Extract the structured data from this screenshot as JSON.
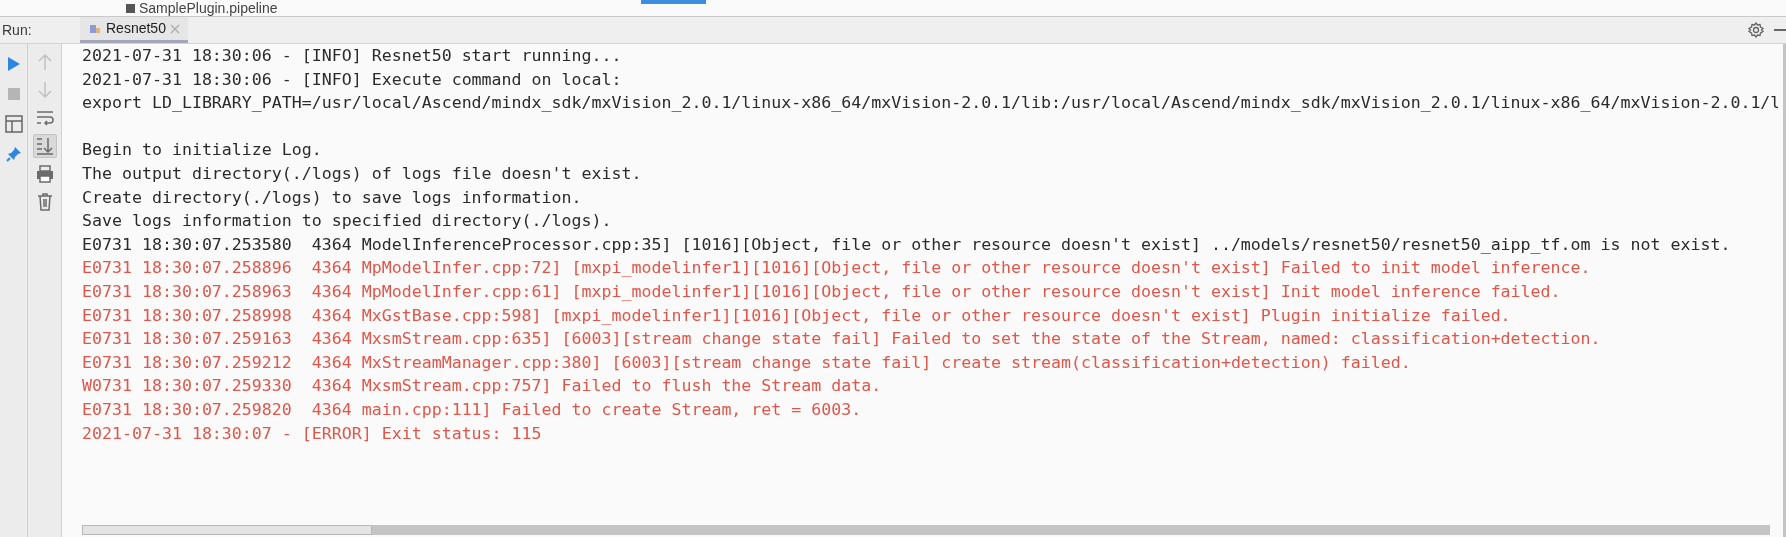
{
  "editor_tab": {
    "label": "SamplePlugin.pipeline"
  },
  "run_panel": {
    "label": "Run:",
    "tabs": [
      {
        "label": "Resnet50",
        "selected": true
      }
    ]
  },
  "left_toolbar": [
    {
      "kind": "run",
      "disabled": false
    },
    {
      "kind": "stop",
      "disabled": true
    },
    {
      "kind": "layout",
      "disabled": false
    },
    {
      "kind": "pin",
      "disabled": false
    }
  ],
  "console_toolbar": [
    {
      "kind": "up",
      "disabled": true,
      "toggled": false
    },
    {
      "kind": "down",
      "disabled": true,
      "toggled": false
    },
    {
      "kind": "wrap",
      "disabled": false,
      "toggled": false
    },
    {
      "kind": "scroll-end",
      "disabled": false,
      "toggled": true
    },
    {
      "kind": "print",
      "disabled": false,
      "toggled": false
    },
    {
      "kind": "trash",
      "disabled": false,
      "toggled": false
    }
  ],
  "console_lines": [
    {
      "kind": "info",
      "text": "2021-07-31 18:30:06 - [INFO] Resnet50 start running..."
    },
    {
      "kind": "info",
      "text": "2021-07-31 18:30:06 - [INFO] Execute command on local:"
    },
    {
      "kind": "info",
      "text": "export LD_LIBRARY_PATH=/usr/local/Ascend/mindx_sdk/mxVision_2.0.1/linux-x86_64/mxVision-2.0.1/lib:/usr/local/Ascend/mindx_sdk/mxVision_2.0.1/linux-x86_64/mxVision-2.0.1/l"
    },
    {
      "kind": "blank"
    },
    {
      "kind": "info",
      "text": "Begin to initialize Log."
    },
    {
      "kind": "info",
      "text": "The output directory(./logs) of logs file doesn't exist."
    },
    {
      "kind": "info",
      "text": "Create directory(./logs) to save logs information."
    },
    {
      "kind": "info",
      "text": "Save logs information to specified directory(./logs)."
    },
    {
      "kind": "info",
      "text": "E0731 18:30:07.253580  4364 ModelInferenceProcessor.cpp:35] [1016][Object, file or other resource doesn't exist] ../models/resnet50/resnet50_aipp_tf.om is not exist."
    },
    {
      "kind": "error",
      "text": "E0731 18:30:07.258896  4364 MpModelInfer.cpp:72] [mxpi_modelinfer1][1016][Object, file or other resource doesn't exist] Failed to init model inference."
    },
    {
      "kind": "error",
      "text": "E0731 18:30:07.258963  4364 MpModelInfer.cpp:61] [mxpi_modelinfer1][1016][Object, file or other resource doesn't exist] Init model inference failed."
    },
    {
      "kind": "error",
      "text": "E0731 18:30:07.258998  4364 MxGstBase.cpp:598] [mxpi_modelinfer1][1016][Object, file or other resource doesn't exist] Plugin initialize failed."
    },
    {
      "kind": "error",
      "text": "E0731 18:30:07.259163  4364 MxsmStream.cpp:635] [6003][stream change state fail] Failed to set the state of the Stream, named: classification+detection."
    },
    {
      "kind": "error",
      "text": "E0731 18:30:07.259212  4364 MxStreamManager.cpp:380] [6003][stream change state fail] create stream(classification+detection) failed."
    },
    {
      "kind": "error",
      "text": "W0731 18:30:07.259330  4364 MxsmStream.cpp:757] Failed to flush the Stream data."
    },
    {
      "kind": "error",
      "text": "E0731 18:30:07.259820  4364 main.cpp:111] Failed to create Stream, ret = 6003."
    },
    {
      "kind": "error",
      "text": "2021-07-31 18:30:07 - [ERROR] Exit status: 115"
    }
  ]
}
